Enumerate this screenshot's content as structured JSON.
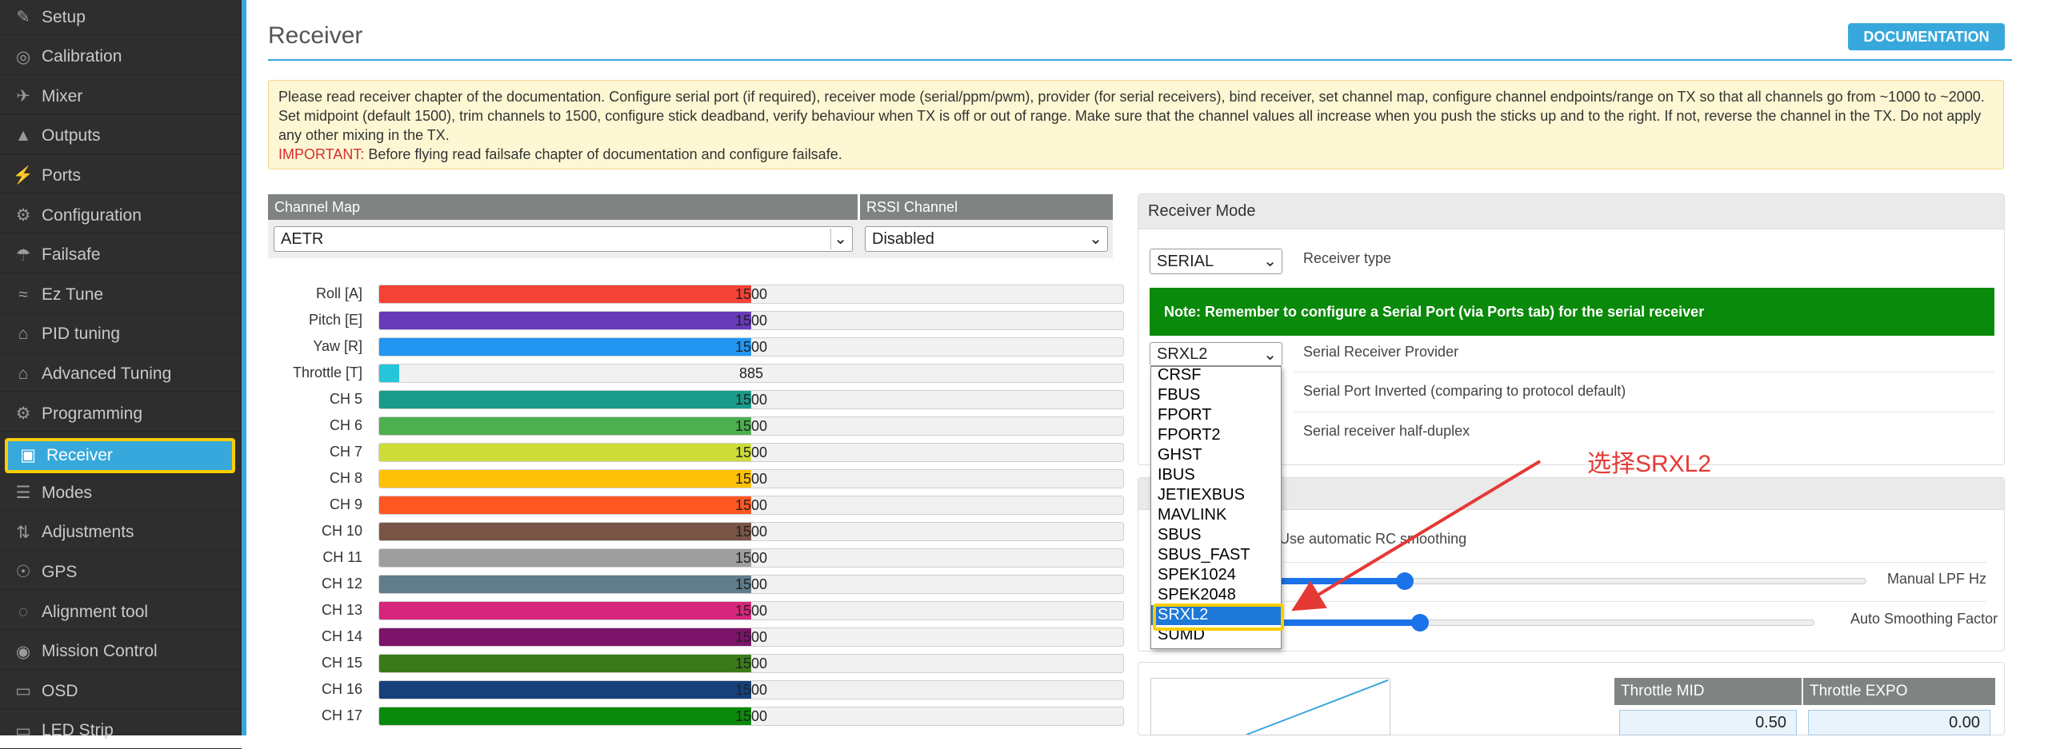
{
  "sidebar": {
    "items": [
      {
        "label": "Setup",
        "icon": "wrench-icon"
      },
      {
        "label": "Calibration",
        "icon": "calibration-icon"
      },
      {
        "label": "Mixer",
        "icon": "mixer-icon"
      },
      {
        "label": "Outputs",
        "icon": "outputs-icon"
      },
      {
        "label": "Ports",
        "icon": "plug-icon"
      },
      {
        "label": "Configuration",
        "icon": "gear-icon"
      },
      {
        "label": "Failsafe",
        "icon": "parachute-icon"
      },
      {
        "label": "Ez Tune",
        "icon": "wave-icon"
      },
      {
        "label": "PID tuning",
        "icon": "pid-icon"
      },
      {
        "label": "Advanced Tuning",
        "icon": "pid-icon"
      },
      {
        "label": "Programming",
        "icon": "gear-icon"
      },
      {
        "label": "Receiver",
        "icon": "receiver-icon",
        "active": true
      },
      {
        "label": "Modes",
        "icon": "modes-icon"
      },
      {
        "label": "Adjustments",
        "icon": "sliders-icon"
      },
      {
        "label": "GPS",
        "icon": "satellite-icon"
      },
      {
        "label": "Alignment tool",
        "icon": "compass-icon"
      },
      {
        "label": "Mission Control",
        "icon": "pin-icon"
      },
      {
        "label": "OSD",
        "icon": "osd-icon"
      },
      {
        "label": "LED Strip",
        "icon": "led-icon"
      }
    ]
  },
  "header": {
    "title": "Receiver",
    "doc_button": "DOCUMENTATION"
  },
  "note": {
    "text": "Please read receiver chapter of the documentation. Configure serial port (if required), receiver mode (serial/ppm/pwm), provider (for serial receivers), bind receiver, set channel map, configure channel endpoints/range on TX so that all channels go from ~1000 to ~2000. Set midpoint (default 1500), trim channels to 1500, configure stick deadband, verify behaviour when TX is off or out of range. Make sure that the channel values all increase when you push the sticks up and to the right. If not, reverse the channel in the TX. Do not apply any other mixing in the TX.",
    "important_label": "IMPORTANT:",
    "important_text": " Before flying read failsafe chapter of documentation and configure failsafe."
  },
  "channel_map": {
    "header": "Channel Map",
    "value": "AETR"
  },
  "rssi": {
    "header": "RSSI Channel",
    "value": "Disabled"
  },
  "channels": [
    {
      "label": "Roll [A]",
      "value": "1500",
      "color": "#f44336"
    },
    {
      "label": "Pitch [E]",
      "value": "1500",
      "color": "#673ab7"
    },
    {
      "label": "Yaw [R]",
      "value": "1500",
      "color": "#2196f3"
    },
    {
      "label": "Throttle [T]",
      "value": "885",
      "color": "#26c6da"
    },
    {
      "label": "CH 5",
      "value": "1500",
      "color": "#1a9a8a"
    },
    {
      "label": "CH 6",
      "value": "1500",
      "color": "#4caf50"
    },
    {
      "label": "CH 7",
      "value": "1500",
      "color": "#cddc39"
    },
    {
      "label": "CH 8",
      "value": "1500",
      "color": "#ffc107"
    },
    {
      "label": "CH 9",
      "value": "1500",
      "color": "#ff5722"
    },
    {
      "label": "CH 10",
      "value": "1500",
      "color": "#795548"
    },
    {
      "label": "CH 11",
      "value": "1500",
      "color": "#9e9e9e"
    },
    {
      "label": "CH 12",
      "value": "1500",
      "color": "#607d8b"
    },
    {
      "label": "CH 13",
      "value": "1500",
      "color": "#d6267c"
    },
    {
      "label": "CH 14",
      "value": "1500",
      "color": "#7b1468"
    },
    {
      "label": "CH 15",
      "value": "1500",
      "color": "#3a7a1a"
    },
    {
      "label": "CH 16",
      "value": "1500",
      "color": "#16407a"
    },
    {
      "label": "CH 17",
      "value": "1500",
      "color": "#0a8a0a"
    }
  ],
  "receiver_mode": {
    "header": "Receiver Mode",
    "type_value": "SERIAL",
    "type_label": "Receiver type",
    "note": "Note: Remember to configure a Serial Port (via Ports tab) for the serial receiver",
    "provider_value": "SRXL2",
    "provider_label": "Serial Receiver Provider",
    "inverted_label": "Serial Port Inverted (comparing to protocol default)",
    "halfduplex_label": "Serial receiver half-duplex"
  },
  "dropdown": {
    "options": [
      "CRSF",
      "FBUS",
      "FPORT",
      "FPORT2",
      "GHST",
      "IBUS",
      "JETIEXBUS",
      "MAVLINK",
      "SBUS",
      "SBUS_FAST",
      "SPEK1024",
      "SPEK2048",
      "SRXL2",
      "SUMD"
    ],
    "selected": "SRXL2"
  },
  "smoothing": {
    "auto_label": "Use automatic RC smoothing",
    "lpf_label": "Manual LPF Hz",
    "lpf_level": 0.25,
    "factor_label": "Auto Smoothing Factor",
    "factor_level": 0.3
  },
  "throttle": {
    "mid_header": "Throttle MID",
    "expo_header": "Throttle EXPO",
    "mid_value": "0.50",
    "expo_value": "0.00"
  },
  "annotation": {
    "text": "选择SRXL2"
  }
}
